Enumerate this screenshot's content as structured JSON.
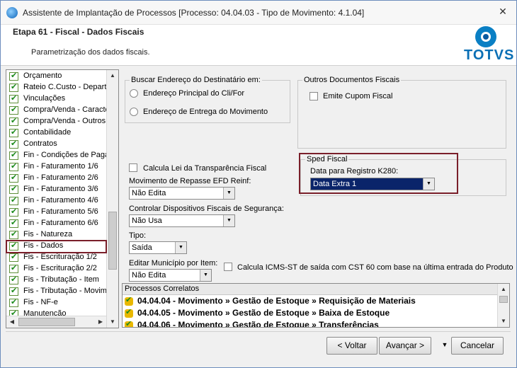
{
  "window": {
    "title": "Assistente de Implantação de Processos [Processo: 04.04.03 - Tipo de Movimento: 4.1.04]",
    "close_glyph": "✕"
  },
  "header": {
    "step": "Etapa 61 - Fiscal - Dados Fiscais",
    "description": "Parametrização dos dados fiscais.",
    "logo_text": "TOTVS"
  },
  "tree": {
    "items": [
      {
        "label": "Orçamento"
      },
      {
        "label": "Rateio C.Custo - Depart"
      },
      {
        "label": "Vinculações"
      },
      {
        "label": "Compra/Venda - Caracte"
      },
      {
        "label": "Compra/Venda - Outros"
      },
      {
        "label": "Contabilidade"
      },
      {
        "label": "Contratos"
      },
      {
        "label": "Fin - Condições de Pagar"
      },
      {
        "label": "Fin - Faturamento 1/6"
      },
      {
        "label": "Fin - Faturamento 2/6"
      },
      {
        "label": "Fin - Faturamento 3/6"
      },
      {
        "label": "Fin - Faturamento 4/6"
      },
      {
        "label": "Fin - Faturamento 5/6"
      },
      {
        "label": "Fin - Faturamento 6/6"
      },
      {
        "label": "Fis - Natureza"
      },
      {
        "label": "Fis - Dados"
      },
      {
        "label": "Fis - Escrituração 1/2"
      },
      {
        "label": "Fis - Escrituração 2/2"
      },
      {
        "label": "Fis - Tributação - Item"
      },
      {
        "label": "Fis - Tributação - Movime"
      },
      {
        "label": "Fis - NF-e"
      },
      {
        "label": "Manutenção"
      }
    ],
    "selected": "Fis - Dados"
  },
  "buscar": {
    "legend": "Buscar Endereço do Destinatário em:",
    "option1": "Endereço Principal do Cli/For",
    "option2": "Endereço de Entrega do Movimento"
  },
  "outros": {
    "legend": "Outros Documentos Fiscais",
    "cupom": "Emite Cupom Fiscal"
  },
  "sped": {
    "legend": "Sped Fiscal",
    "label": "Data para Registro K280:",
    "value": "Data Extra 1"
  },
  "fields": {
    "lei_transparencia": "Calcula Lei da Transparência Fiscal",
    "repasse_label": "Movimento de Repasse EFD Reinf:",
    "repasse_value": "Não Edita",
    "dispositivos_label": "Controlar Dispositivos Fiscais de Segurança:",
    "dispositivos_value": "Não Usa",
    "tipo_label": "Tipo:",
    "tipo_value": "Saída",
    "municipio_label": "Editar Município por Item:",
    "municipio_value": "Não Edita",
    "icms_label": "Calcula ICMS-ST de saída com CST 60 com base na última entrada do Produto"
  },
  "correlatos": {
    "header": "Processos Correlatos",
    "rows": [
      "04.04.04 - Movimento » Gestão de Estoque » Requisição de Materiais",
      "04.04.05 - Movimento » Gestão de Estoque » Baixa de Estoque",
      "04.04.06 - Movimento » Gestão de Estoque » Transferências"
    ]
  },
  "footer": {
    "voltar": "< Voltar",
    "avancar": "Avançar >",
    "cancelar": "Cancelar"
  }
}
